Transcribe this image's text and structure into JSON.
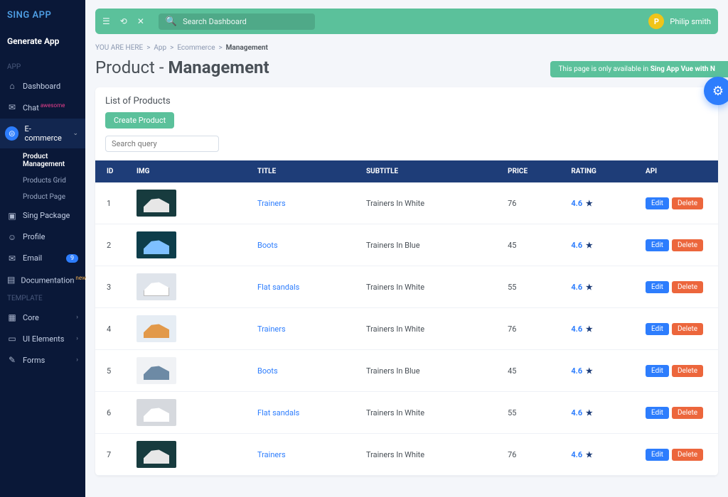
{
  "brand": "SING APP",
  "generate_label": "Generate App",
  "nav_section_app": "APP",
  "nav_section_template": "TEMPLATE",
  "nav": {
    "dashboard": "Dashboard",
    "chat": "Chat",
    "chat_sup": "awesome",
    "ecommerce": "E-commerce",
    "sub": {
      "product_mgmt": "Product Management",
      "products_grid": "Products Grid",
      "product_page": "Product Page"
    },
    "sing_package": "Sing Package",
    "profile": "Profile",
    "email": "Email",
    "email_badge": "9",
    "documentation": "Documentation",
    "doc_sup": "new",
    "core": "Core",
    "ui_elements": "UI Elements",
    "forms": "Forms"
  },
  "topbar": {
    "search_placeholder": "Search Dashboard",
    "user_initial": "P",
    "user_name": "Philip smith"
  },
  "breadcrumb": {
    "here": "YOU ARE HERE",
    "app": "App",
    "ecom": "Ecommerce",
    "mgmt": "Management"
  },
  "page_title_a": "Product - ",
  "page_title_b": "Management",
  "notice_a": "This page is only available in ",
  "notice_b": "Sing App Vue with N",
  "panel": {
    "title": "List of Products",
    "create": "Create Product",
    "search_placeholder": "Search query"
  },
  "columns": {
    "id": "ID",
    "img": "IMG",
    "title": "TITLE",
    "subtitle": "SUBTITLE",
    "price": "PRICE",
    "rating": "RATING",
    "api": "API"
  },
  "actions": {
    "edit": "Edit",
    "delete": "Delete"
  },
  "products": [
    {
      "id": "1",
      "title": "Trainers",
      "subtitle": "Trainers In White",
      "price": "76",
      "rating": "4.6",
      "thumb": "t1"
    },
    {
      "id": "2",
      "title": "Boots",
      "subtitle": "Trainers In Blue",
      "price": "45",
      "rating": "4.6",
      "thumb": "t2"
    },
    {
      "id": "3",
      "title": "Flat sandals",
      "subtitle": "Trainers In White",
      "price": "55",
      "rating": "4.6",
      "thumb": "t3"
    },
    {
      "id": "4",
      "title": "Trainers",
      "subtitle": "Trainers In White",
      "price": "76",
      "rating": "4.6",
      "thumb": "t4"
    },
    {
      "id": "5",
      "title": "Boots",
      "subtitle": "Trainers In Blue",
      "price": "45",
      "rating": "4.6",
      "thumb": "t5"
    },
    {
      "id": "6",
      "title": "Flat sandals",
      "subtitle": "Trainers In White",
      "price": "55",
      "rating": "4.6",
      "thumb": "t6"
    },
    {
      "id": "7",
      "title": "Trainers",
      "subtitle": "Trainers In White",
      "price": "76",
      "rating": "4.6",
      "thumb": "t1"
    }
  ]
}
